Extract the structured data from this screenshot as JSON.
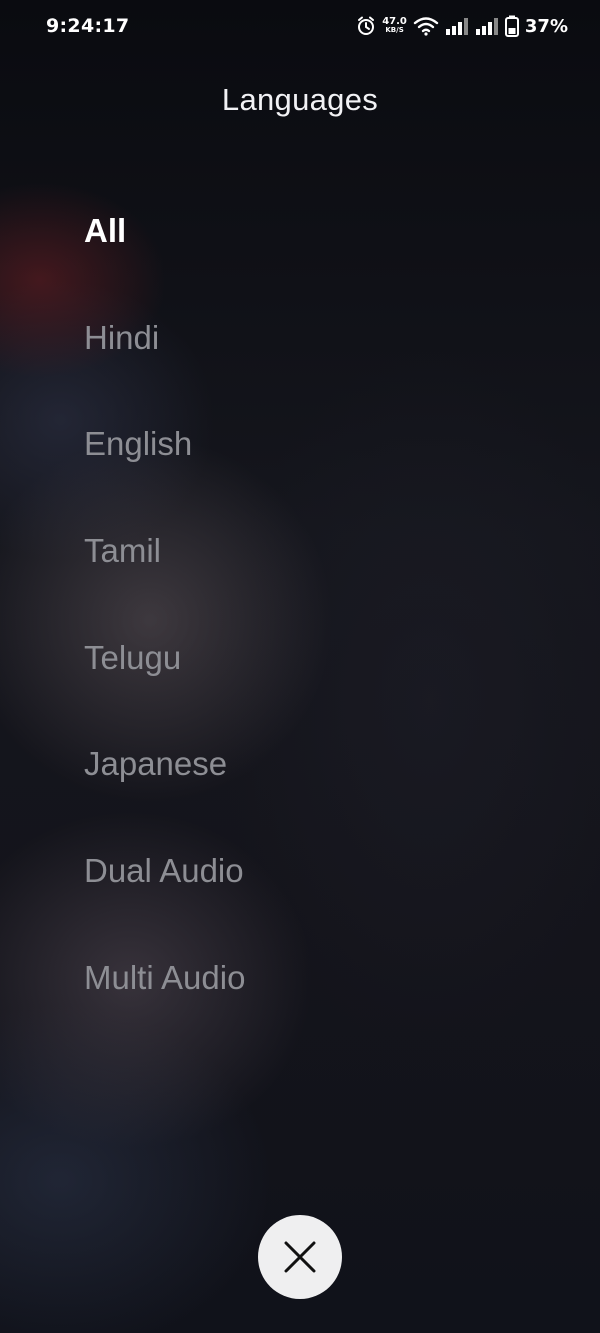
{
  "status_bar": {
    "time": "9:24:17",
    "net_speed_value": "47.0",
    "net_speed_unit": "KB/S",
    "battery": "37%",
    "icons": [
      "alarm-icon",
      "wifi-icon",
      "signal-icon",
      "signal-icon",
      "battery-icon"
    ]
  },
  "header": {
    "title": "Languages"
  },
  "languages": {
    "items": [
      {
        "label": "All",
        "selected": true
      },
      {
        "label": "Hindi",
        "selected": false
      },
      {
        "label": "English",
        "selected": false
      },
      {
        "label": "Tamil",
        "selected": false
      },
      {
        "label": "Telugu",
        "selected": false
      },
      {
        "label": "Japanese",
        "selected": false
      },
      {
        "label": "Dual Audio",
        "selected": false
      },
      {
        "label": "Multi Audio",
        "selected": false
      }
    ]
  },
  "close_button": {
    "icon": "close-icon"
  },
  "colors": {
    "selected_text": "#ffffff",
    "unselected_text": "#8d8e94",
    "close_button_bg": "#efeff0"
  }
}
